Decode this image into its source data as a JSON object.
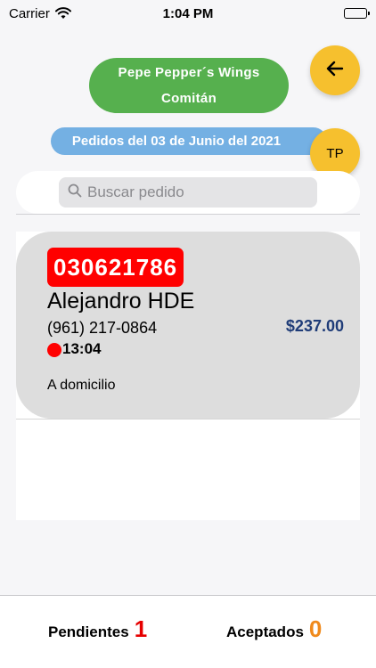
{
  "status_bar": {
    "carrier": "Carrier",
    "time": "1:04 PM"
  },
  "header": {
    "restaurant_name": "Pepe Pepper´s Wings",
    "restaurant_city": "Comitán",
    "date_label": "Pedidos del 03 de Junio del 2021",
    "avatar_initials": "TP"
  },
  "search": {
    "placeholder": "Buscar pedido",
    "value": ""
  },
  "orders": [
    {
      "number": "030621786",
      "customer": "Alejandro HDE",
      "phone": "(961) 217-0864",
      "time": "13:04",
      "delivery": "A domicilio",
      "total": "$237.00"
    }
  ],
  "tabs": {
    "pending_label": "Pendientes",
    "pending_count": "1",
    "accepted_label": "Aceptados",
    "accepted_count": "0"
  },
  "colors": {
    "restaurant_pill": "#56b04e",
    "date_pill": "#74b0e3",
    "action_buttons": "#f6c02e",
    "order_number_badge": "#ff0000",
    "total_text": "#1f3c78",
    "pending_count": "#e60000",
    "accepted_count": "#f08a1c"
  },
  "icons": {
    "back": "arrow-left-icon",
    "search": "magnifier-icon",
    "status_dot": "red-dot-icon"
  }
}
